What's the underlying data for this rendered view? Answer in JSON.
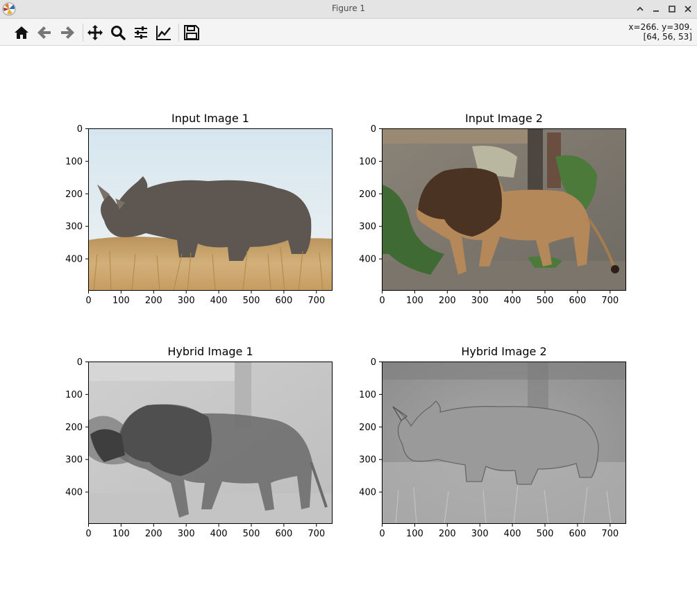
{
  "window": {
    "title": "Figure 1"
  },
  "toolbar": {
    "buttons": [
      {
        "name": "home-icon"
      },
      {
        "name": "back-arrow-icon"
      },
      {
        "name": "forward-arrow-icon"
      },
      {
        "name": "pan-icon"
      },
      {
        "name": "zoom-icon"
      },
      {
        "name": "configure-subplots-icon"
      },
      {
        "name": "edit-axis-icon"
      },
      {
        "name": "save-icon"
      }
    ],
    "coords_line1": "x=266. y=309.",
    "coords_line2": "[64, 56, 53]"
  },
  "figure": {
    "panels": [
      {
        "title": "Input Image 1",
        "image": "rhinoceros photo in dry grass"
      },
      {
        "title": "Input Image 2",
        "image": "lion photo on stone ledge"
      },
      {
        "title": "Hybrid Image 1",
        "image": "grayscale hybrid, lion dominant"
      },
      {
        "title": "Hybrid Image 2",
        "image": "grayscale hybrid, rhino edges over blur"
      }
    ],
    "x_ticks": [
      "0",
      "100",
      "200",
      "300",
      "400",
      "500",
      "600",
      "700"
    ],
    "y_ticks": [
      "0",
      "100",
      "200",
      "300",
      "400"
    ]
  },
  "colors": {
    "titlebar": "#e4e4e4",
    "toolbar": "#f4f4f4",
    "sky": "#dfe9f0",
    "grass": "#c9a46a"
  }
}
